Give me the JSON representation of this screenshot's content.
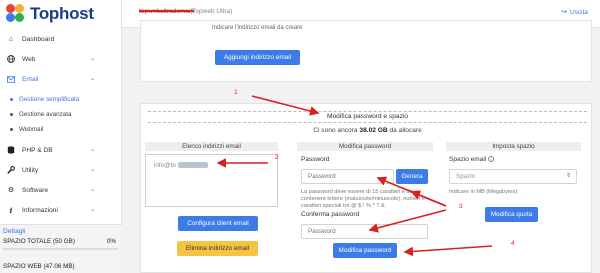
{
  "brand": {
    "name": "Tophost"
  },
  "header": {
    "domain": "topwebultradomain",
    "plan": "(Topweb Ultra)",
    "logout_label": "Uscita"
  },
  "sidebar": {
    "items": [
      {
        "label": "Dashboard",
        "icon": "home-icon"
      },
      {
        "label": "Web",
        "icon": "globe-icon"
      },
      {
        "label": "Email",
        "icon": "envelope-icon"
      },
      {
        "label": "PHP & DB",
        "icon": "database-icon"
      },
      {
        "label": "Utility",
        "icon": "wrench-icon"
      },
      {
        "label": "Software",
        "icon": "cog-icon"
      },
      {
        "label": "Informazioni",
        "icon": "info-icon"
      }
    ],
    "email_sub": [
      "Gestione semplificata",
      "Gestione avanzata",
      "Webmail"
    ],
    "details_label": "Dettagli",
    "quota_total_label": "SPAZIO TOTALE (50 GB)",
    "quota_total_value": "0%",
    "quota_total_fraction": 0.0,
    "quota_web_label": "SPAZIO WEB (47.06 MB)"
  },
  "add_panel": {
    "hint": "Indicare l'indirizzo email da creare",
    "add_button": "Aggiungi indirizzo email"
  },
  "manage_panel": {
    "title": "Modifica password e spazio",
    "avail_prefix": "Ci sono ancora",
    "avail_value": "38.02 GB",
    "avail_suffix": "da allocare",
    "col_list": "Elenco indirizzi email",
    "col_password": "Modifica password",
    "col_space": "Imposta spazio",
    "email_entry": "info@to",
    "client_button": "Configura client email",
    "delete_button": "Elimina indirizzo email",
    "password_label": "Password",
    "password_placeholder": "Password",
    "generate_button": "Genera",
    "password_help": "La password deve essere di 15 caratteri e deve contenere lettere (maiuscole/minuscole), numeri e caratteri speciali tra @ $ ! % * ? &",
    "confirm_label": "Conferma password",
    "confirm_placeholder": "Password",
    "change_password_button": "Modifica password",
    "space_label": "Spazio email",
    "space_placeholder": "Spazio",
    "space_help": "Indicare in MB (Megabytes)",
    "change_quota_button": "Modifica quota"
  },
  "annotations": [
    "1",
    "2",
    "3",
    "4"
  ],
  "colors": {
    "accent": "#3d7be8",
    "warning": "#f6c342",
    "annotation": "#d92020",
    "brand": "#1d3b8f"
  }
}
